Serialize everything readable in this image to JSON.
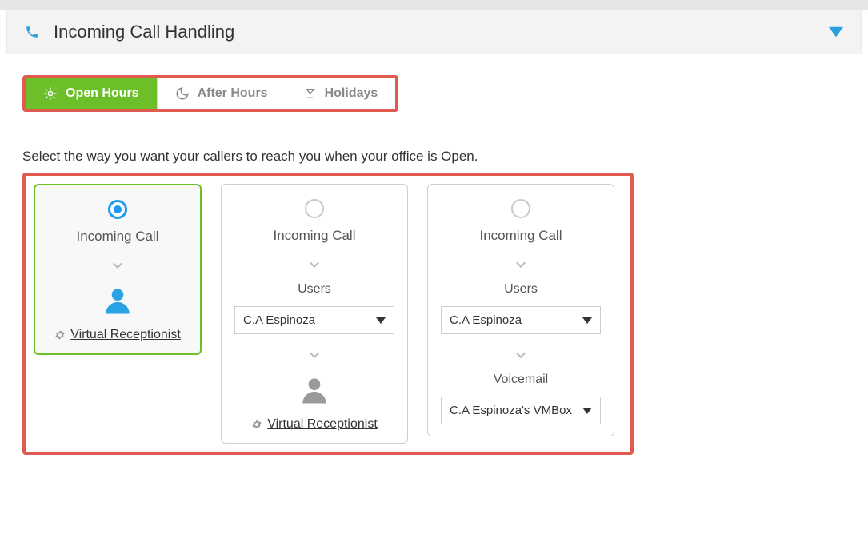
{
  "header": {
    "title": "Incoming Call Handling"
  },
  "tabs": {
    "open_hours": "Open Hours",
    "after_hours": "After Hours",
    "holidays": "Holidays"
  },
  "instruction": "Select the way you want your callers to reach you when your office is Open.",
  "options": {
    "card1": {
      "incoming": "Incoming Call",
      "vr_label": "Virtual Receptionist"
    },
    "card2": {
      "incoming": "Incoming Call",
      "users_label": "Users",
      "user_selected": "C.A Espinoza",
      "vr_label": "Virtual Receptionist"
    },
    "card3": {
      "incoming": "Incoming Call",
      "users_label": "Users",
      "user_selected": "C.A Espinoza",
      "voicemail_label": "Voicemail",
      "vm_selected": "C.A Espinoza's VMBox"
    }
  }
}
